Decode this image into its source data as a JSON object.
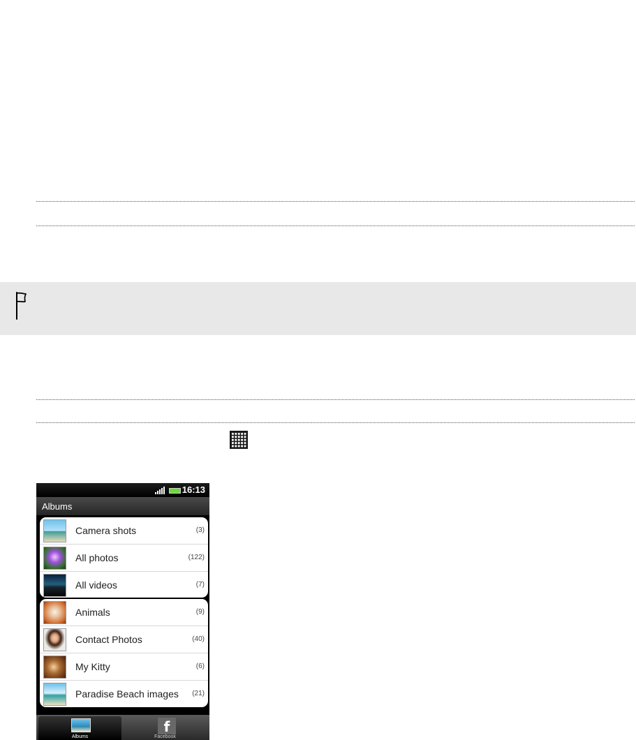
{
  "phone": {
    "status": {
      "time": "16:13",
      "signal_icon": "signal-bars-icon",
      "battery_icon": "battery-icon"
    },
    "title": "Albums",
    "groups": [
      [
        {
          "label": "Camera shots",
          "count": "(3)",
          "thumb": "beach"
        },
        {
          "label": "All photos",
          "count": "(122)",
          "thumb": "flower"
        },
        {
          "label": "All videos",
          "count": "(7)",
          "thumb": "video"
        }
      ],
      [
        {
          "label": "Animals",
          "count": "(9)",
          "thumb": "dog"
        },
        {
          "label": "Contact Photos",
          "count": "(40)",
          "thumb": "person"
        },
        {
          "label": "My Kitty",
          "count": "(6)",
          "thumb": "kitty"
        },
        {
          "label": "Paradise Beach images",
          "count": "(21)",
          "thumb": "para"
        }
      ]
    ],
    "tabs": [
      {
        "label": "Albums",
        "icon": "albums-icon",
        "selected": true
      },
      {
        "label": "Facebook",
        "icon": "facebook-icon",
        "selected": false
      }
    ]
  },
  "icons": {
    "note": "flag-icon",
    "apps": "all-apps-grid-icon"
  },
  "colors": {
    "note_background": "#e8e8e8",
    "battery": "#6fd83e"
  }
}
